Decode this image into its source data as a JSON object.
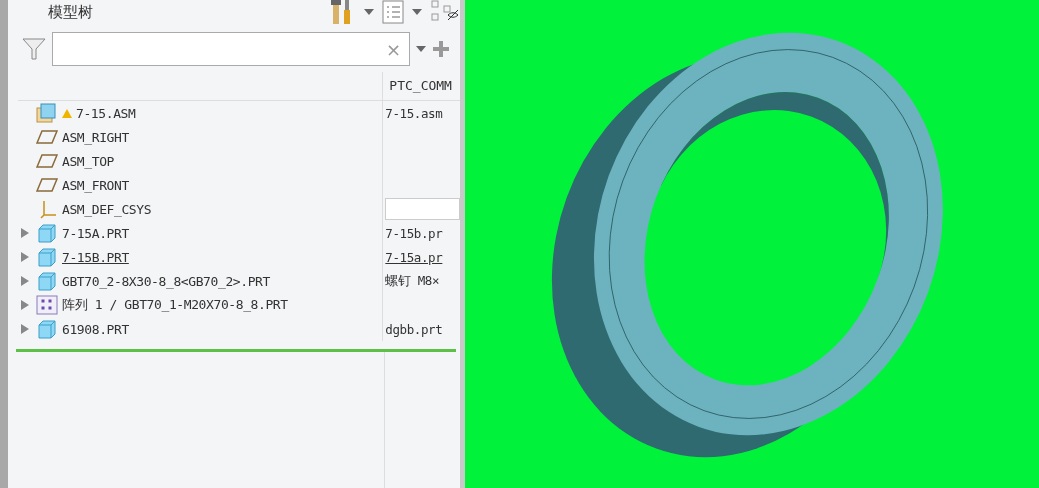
{
  "panel": {
    "title": "模型树",
    "filter": {
      "clear": "×"
    }
  },
  "columns": {
    "column_2": "PTC_COMM"
  },
  "tree": [
    {
      "kind": "asm",
      "label": "7-15.ASM",
      "warning": true,
      "comment": "7-15.asm",
      "children": [
        {
          "kind": "plane",
          "label": "ASM_RIGHT"
        },
        {
          "kind": "plane",
          "label": "ASM_TOP"
        },
        {
          "kind": "plane",
          "label": "ASM_FRONT"
        },
        {
          "kind": "csys",
          "label": "ASM_DEF_CSYS",
          "comment_field": true
        },
        {
          "kind": "part",
          "label": "7-15A.PRT",
          "expanded": false,
          "underlined": false,
          "comment": "7-15b.pr"
        },
        {
          "kind": "part",
          "label": "7-15B.PRT",
          "expanded": false,
          "underlined": true,
          "comment": "7-15a.pr"
        },
        {
          "kind": "part",
          "label": "GBT70_2-8X30-8_8<GB70_2>.PRT",
          "expanded": false,
          "underlined": false,
          "comment": "螺钉 M8×"
        },
        {
          "kind": "pattern",
          "label": "阵列 1 / GBT70_1-M20X70-8_8.PRT",
          "expanded": false,
          "underlined": false
        },
        {
          "kind": "part",
          "label": "61908.PRT",
          "expanded": false,
          "underlined": false,
          "comment": "dgbb.prt"
        }
      ]
    }
  ]
}
